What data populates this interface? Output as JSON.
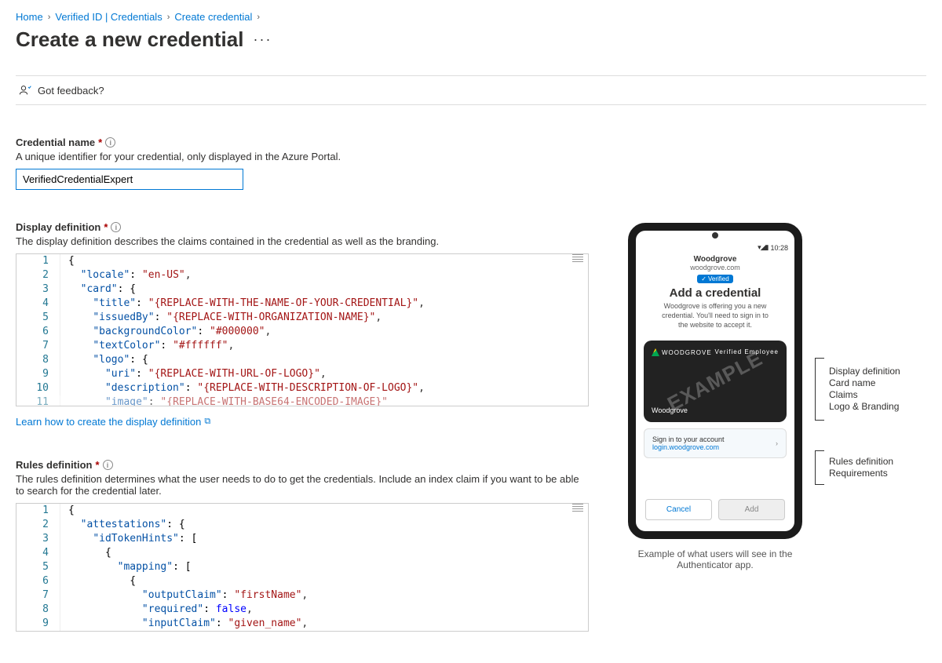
{
  "breadcrumb": {
    "home": "Home",
    "verified": "Verified ID | Credentials",
    "create": "Create credential"
  },
  "page": {
    "title": "Create a new credential",
    "feedback": "Got feedback?"
  },
  "cred_name": {
    "label": "Credential name",
    "hint": "A unique identifier for your credential, only displayed in the Azure Portal.",
    "value": "VerifiedCredentialExpert"
  },
  "display_def": {
    "label": "Display definition",
    "hint": "The display definition describes the claims contained in the credential as well as the branding.",
    "learn": "Learn how to create the display definition",
    "lines": [
      "1",
      "2",
      "3",
      "4",
      "5",
      "6",
      "7",
      "8",
      "9",
      "10",
      "11"
    ],
    "code_plain": "{\n  \"locale\": \"en-US\",\n  \"card\": {\n    \"title\": \"{REPLACE-WITH-THE-NAME-OF-YOUR-CREDENTIAL}\",\n    \"issuedBy\": \"{REPLACE-WITH-ORGANIZATION-NAME}\",\n    \"backgroundColor\": \"#000000\",\n    \"textColor\": \"#ffffff\",\n    \"logo\": {\n      \"uri\": \"{REPLACE-WITH-URL-OF-LOGO}\",\n      \"description\": \"{REPLACE-WITH-DESCRIPTION-OF-LOGO}\",\n      \"image\": \"{REPLACE-WITH-BASE64-ENCODED-IMAGE}\""
  },
  "rules_def": {
    "label": "Rules definition",
    "hint": "The rules definition determines what the user needs to do to get the credentials. Include an index claim if you want to be able to search for the credential later.",
    "lines": [
      "1",
      "2",
      "3",
      "4",
      "5",
      "6",
      "7",
      "8",
      "9"
    ],
    "code_plain": "{\n  \"attestations\": {\n    \"idTokenHints\": [\n      {\n        \"mapping\": [\n          {\n            \"outputClaim\": \"firstName\",\n            \"required\": false,\n            \"inputClaim\": \"given_name\","
  },
  "phone": {
    "time": "10:28",
    "company": "Woodgrove",
    "domain": "woodgrove.com",
    "verified": "Verified",
    "title": "Add a credential",
    "sub": "Woodgrove is offering you a new credential. You'll need to sign in to the website to accept it.",
    "card_brand": "WOODGROVE",
    "card_type": "Verified Employee",
    "card_company": "Woodgrove",
    "watermark": "EXAMPLE",
    "signin_title": "Sign in to your account",
    "signin_link": "login.woodgrove.com",
    "cancel": "Cancel",
    "add": "Add",
    "caption": "Example of what users will see in the Authenticator app."
  },
  "annot": {
    "a1": "Display definition",
    "a2": "Card name",
    "a3": "Claims",
    "a4": "Logo & Branding",
    "b1": "Rules definition",
    "b2": "Requirements"
  }
}
